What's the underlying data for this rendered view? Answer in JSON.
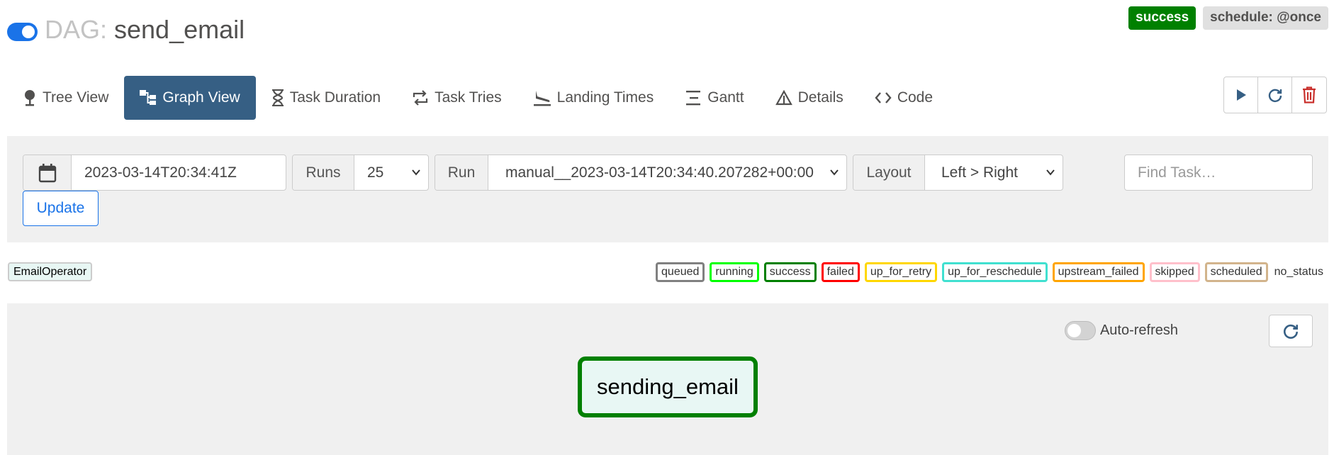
{
  "header": {
    "dag_label": "DAG:",
    "dag_id": "send_email",
    "status_badge": "success",
    "schedule_badge": "schedule: @once"
  },
  "tabs": [
    {
      "label": "Tree View",
      "icon": "tree-icon",
      "active": false
    },
    {
      "label": "Graph View",
      "icon": "graph-icon",
      "active": true
    },
    {
      "label": "Task Duration",
      "icon": "hourglass-icon",
      "active": false
    },
    {
      "label": "Task Tries",
      "icon": "repeat-icon",
      "active": false
    },
    {
      "label": "Landing Times",
      "icon": "plane-landing-icon",
      "active": false
    },
    {
      "label": "Gantt",
      "icon": "gantt-icon",
      "active": false
    },
    {
      "label": "Details",
      "icon": "triangle-warning-icon",
      "active": false
    },
    {
      "label": "Code",
      "icon": "code-icon",
      "active": false
    }
  ],
  "actions": [
    "play-icon",
    "refresh-icon",
    "trash-icon"
  ],
  "filters": {
    "base_date": "2023-03-14T20:34:41Z",
    "runs_label": "Runs",
    "runs_value": "25",
    "run_label": "Run",
    "run_value": "manual__2023-03-14T20:34:40.207282+00:00",
    "layout_label": "Layout",
    "layout_value": "Left > Right",
    "find_placeholder": "Find Task…",
    "update_label": "Update"
  },
  "legend": {
    "operator": "EmailOperator",
    "states": [
      {
        "label": "queued",
        "color": "#808080"
      },
      {
        "label": "running",
        "color": "#00ff00"
      },
      {
        "label": "success",
        "color": "#008000"
      },
      {
        "label": "failed",
        "color": "#ff0000"
      },
      {
        "label": "up_for_retry",
        "color": "#ffd700"
      },
      {
        "label": "up_for_reschedule",
        "color": "#40e0d0"
      },
      {
        "label": "upstream_failed",
        "color": "#ffa500"
      },
      {
        "label": "skipped",
        "color": "#ffc0cb"
      },
      {
        "label": "scheduled",
        "color": "#d2b48c"
      }
    ],
    "no_status": "no_status"
  },
  "graph": {
    "auto_refresh_label": "Auto-refresh",
    "task": "sending_email"
  },
  "colors": {
    "accent": "#365f84",
    "link": "#1a73e8",
    "success": "#008000",
    "danger": "#c9302c"
  }
}
